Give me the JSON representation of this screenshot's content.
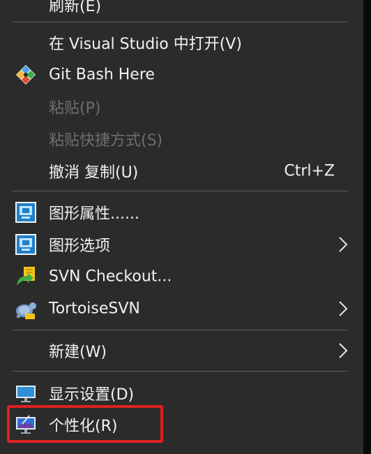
{
  "context_menu": {
    "items": [
      {
        "label": "刷新(E)",
        "disabled": false
      },
      {
        "label": "在 Visual Studio 中打开(V)",
        "disabled": false
      },
      {
        "label": "Git Bash Here",
        "icon": "git-icon",
        "disabled": false
      },
      {
        "label": "粘贴(P)",
        "disabled": true
      },
      {
        "label": "粘贴快捷方式(S)",
        "disabled": true
      },
      {
        "label": "撤消 复制(U)",
        "shortcut": "Ctrl+Z",
        "disabled": false
      },
      {
        "label": "图形属性......",
        "icon": "graphics-properties-icon",
        "disabled": false
      },
      {
        "label": "图形选项",
        "icon": "graphics-options-icon",
        "submenu": true,
        "disabled": false
      },
      {
        "label": "SVN Checkout...",
        "icon": "svn-checkout-icon",
        "disabled": false
      },
      {
        "label": "TortoiseSVN",
        "icon": "tortoisesvn-icon",
        "submenu": true,
        "disabled": false
      },
      {
        "label": "新建(W)",
        "submenu": true,
        "disabled": false
      },
      {
        "label": "显示设置(D)",
        "icon": "display-settings-icon",
        "disabled": false
      },
      {
        "label": "个性化(R)",
        "icon": "personalize-icon",
        "disabled": false,
        "highlighted": true
      }
    ]
  },
  "colors": {
    "menu_background": "#2b2b2b",
    "text": "#f2f2f2",
    "disabled_text": "#6d6d6d",
    "separator": "#626262",
    "highlight_border": "#e02020"
  }
}
